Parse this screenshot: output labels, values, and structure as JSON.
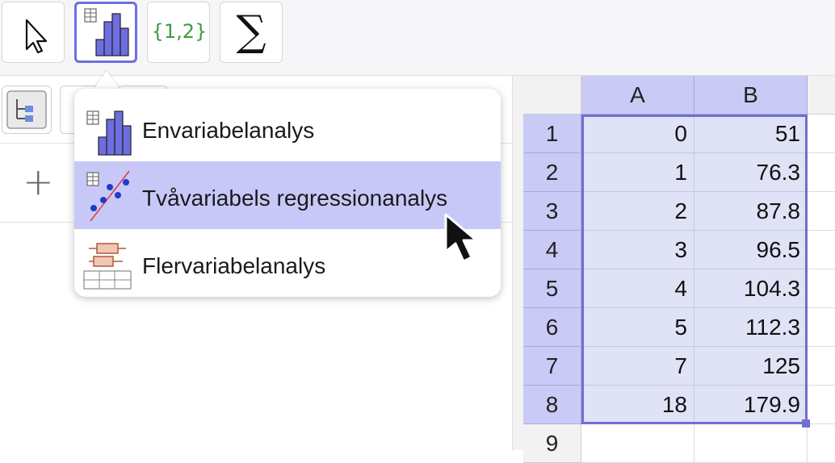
{
  "toolbar": {
    "tools": [
      {
        "name": "move-tool",
        "icon": "pointer-arrow-icon"
      },
      {
        "name": "data-analysis-tool",
        "icon": "histogram-table-icon",
        "active": true
      },
      {
        "name": "list-tool",
        "icon": "set-braces-icon",
        "label": "{1,2}"
      },
      {
        "name": "sum-tool",
        "icon": "sigma-icon",
        "label": "∑"
      }
    ]
  },
  "left_panel": {
    "add_label": "+"
  },
  "menu": {
    "items": [
      {
        "label": "Envariabelanalys",
        "icon": "one-variable-histogram-icon",
        "highlighted": false
      },
      {
        "label": "Tvåvariabels regressionanalys",
        "icon": "two-variable-scatter-icon",
        "highlighted": true
      },
      {
        "label": "Flervariabelanalys",
        "icon": "multi-variable-boxplot-icon",
        "highlighted": false
      }
    ]
  },
  "spreadsheet": {
    "columns": [
      "A",
      "B"
    ],
    "rows": [
      {
        "n": "1",
        "a": "0",
        "b": "51"
      },
      {
        "n": "2",
        "a": "1",
        "b": "76.3"
      },
      {
        "n": "3",
        "a": "2",
        "b": "87.8"
      },
      {
        "n": "4",
        "a": "3",
        "b": "96.5"
      },
      {
        "n": "5",
        "a": "4",
        "b": "104.3"
      },
      {
        "n": "6",
        "a": "5",
        "b": "112.3"
      },
      {
        "n": "7",
        "a": "7",
        "b": "125"
      },
      {
        "n": "8",
        "a": "18",
        "b": "179.9"
      },
      {
        "n": "9",
        "a": "",
        "b": ""
      }
    ]
  },
  "colors": {
    "accent": "#6e6ee0",
    "header_bg": "#cacaf6",
    "selected_cell_bg": "#dfe3f5",
    "menu_highlight": "#c8c8f8"
  }
}
